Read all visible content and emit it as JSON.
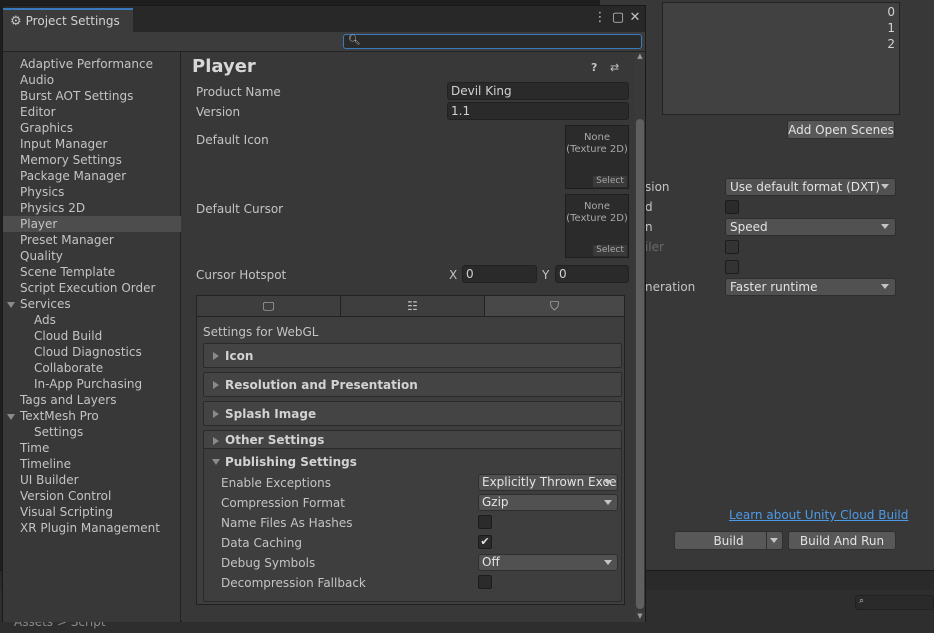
{
  "background": {
    "scene_indices": [
      "0",
      "1",
      "2"
    ],
    "add_open_scenes": "Add Open Scenes",
    "rows": [
      {
        "label": "sion",
        "type": "dropdown",
        "value": "Use default format (DXT)",
        "dim": false
      },
      {
        "label": "d",
        "type": "checkbox",
        "dim": false
      },
      {
        "label": "n",
        "type": "dropdown",
        "value": "Speed",
        "dim": false
      },
      {
        "label": "iler",
        "type": "checkbox",
        "dim": true
      },
      {
        "label": "",
        "type": "checkbox",
        "dim": true
      },
      {
        "label": "neration",
        "type": "dropdown",
        "value": "Faster runtime",
        "dim": false
      }
    ],
    "cloud_build_link": "Learn about Unity Cloud Build",
    "build_button": "Build",
    "build_and_run_button": "Build And Run",
    "breadcrumb": "Assets > Script"
  },
  "window": {
    "title": "Project Settings",
    "menu_icon": "⋮",
    "maximize_icon": "▢",
    "close_icon": "✕"
  },
  "search": {
    "placeholder": "",
    "value": ""
  },
  "sidebar": {
    "items": [
      {
        "label": "Adaptive Performance",
        "indent": 0,
        "selected": false
      },
      {
        "label": "Audio",
        "indent": 0,
        "selected": false
      },
      {
        "label": "Burst AOT Settings",
        "indent": 0,
        "selected": false
      },
      {
        "label": "Editor",
        "indent": 0,
        "selected": false
      },
      {
        "label": "Graphics",
        "indent": 0,
        "selected": false
      },
      {
        "label": "Input Manager",
        "indent": 0,
        "selected": false
      },
      {
        "label": "Memory Settings",
        "indent": 0,
        "selected": false
      },
      {
        "label": "Package Manager",
        "indent": 0,
        "selected": false
      },
      {
        "label": "Physics",
        "indent": 0,
        "selected": false
      },
      {
        "label": "Physics 2D",
        "indent": 0,
        "selected": false
      },
      {
        "label": "Player",
        "indent": 0,
        "selected": true
      },
      {
        "label": "Preset Manager",
        "indent": 0,
        "selected": false
      },
      {
        "label": "Quality",
        "indent": 0,
        "selected": false
      },
      {
        "label": "Scene Template",
        "indent": 0,
        "selected": false
      },
      {
        "label": "Script Execution Order",
        "indent": 0,
        "selected": false
      },
      {
        "label": "Services",
        "indent": 0,
        "selected": false,
        "expanded": true
      },
      {
        "label": "Ads",
        "indent": 1,
        "selected": false
      },
      {
        "label": "Cloud Build",
        "indent": 1,
        "selected": false
      },
      {
        "label": "Cloud Diagnostics",
        "indent": 1,
        "selected": false
      },
      {
        "label": "Collaborate",
        "indent": 1,
        "selected": false
      },
      {
        "label": "In-App Purchasing",
        "indent": 1,
        "selected": false
      },
      {
        "label": "Tags and Layers",
        "indent": 0,
        "selected": false
      },
      {
        "label": "TextMesh Pro",
        "indent": 0,
        "selected": false,
        "expanded": true
      },
      {
        "label": "Settings",
        "indent": 1,
        "selected": false
      },
      {
        "label": "Time",
        "indent": 0,
        "selected": false
      },
      {
        "label": "Timeline",
        "indent": 0,
        "selected": false
      },
      {
        "label": "UI Builder",
        "indent": 0,
        "selected": false
      },
      {
        "label": "Version Control",
        "indent": 0,
        "selected": false
      },
      {
        "label": "Visual Scripting",
        "indent": 0,
        "selected": false
      },
      {
        "label": "XR Plugin Management",
        "indent": 0,
        "selected": false
      }
    ]
  },
  "player": {
    "title": "Player",
    "product_name_label": "Product Name",
    "product_name_value": "Devil King",
    "version_label": "Version",
    "version_value": "1.1",
    "default_icon_label": "Default Icon",
    "default_cursor_label": "Default Cursor",
    "texture_none": "None",
    "texture_type": "(Texture 2D)",
    "texture_select": "Select",
    "cursor_hotspot_label": "Cursor Hotspot",
    "hotspot_x_label": "X",
    "hotspot_x_value": "0",
    "hotspot_y_label": "Y",
    "hotspot_y_value": "0"
  },
  "platform_tabs": [
    {
      "icon": "monitor-icon",
      "glyph": "🖵",
      "active": false
    },
    {
      "icon": "server-icon",
      "glyph": "☷",
      "active": false
    },
    {
      "icon": "html5-icon",
      "glyph": "⛉",
      "active": true
    }
  ],
  "settings_for": "Settings for WebGL",
  "sections": [
    "Icon",
    "Resolution and Presentation",
    "Splash Image",
    "Other Settings"
  ],
  "publishing": {
    "title": "Publishing Settings",
    "rows": [
      {
        "label": "Enable Exceptions",
        "type": "dropdown",
        "value": "Explicitly Thrown Exce"
      },
      {
        "label": "Compression Format",
        "type": "dropdown",
        "value": "Gzip"
      },
      {
        "label": "Name Files As Hashes",
        "type": "checkbox",
        "checked": false
      },
      {
        "label": "Data Caching",
        "type": "checkbox",
        "checked": true
      },
      {
        "label": "Debug Symbols",
        "type": "dropdown",
        "value": "Off"
      },
      {
        "label": "Decompression Fallback",
        "type": "checkbox",
        "checked": false
      }
    ]
  }
}
